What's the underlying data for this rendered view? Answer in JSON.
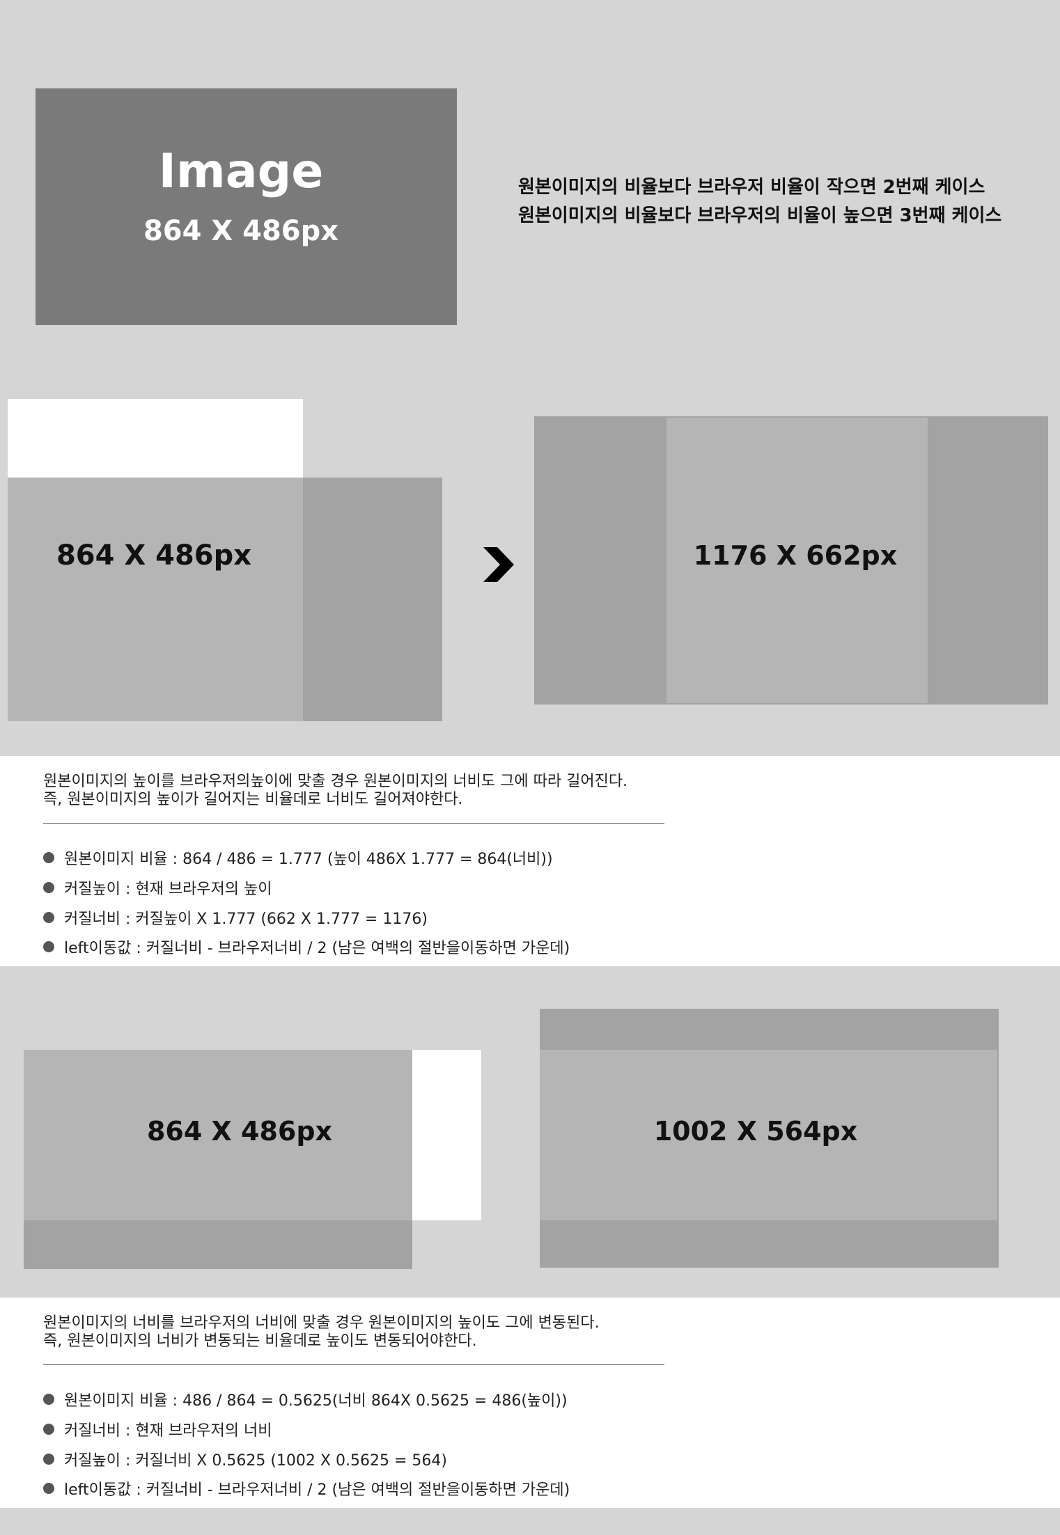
{
  "colors": {
    "background": "#d5d5d5",
    "image_block": "#7a7a7a",
    "light_box": "#b5b5b5",
    "mid_box": "#a3a3a3",
    "white": "#ffffff"
  },
  "top": {
    "image_title": "Image",
    "image_size": "864 X 486px",
    "note_line_1": "원본이미지의 비율보다 브라우저 비율이 작으면 2번째 케이스",
    "note_line_2": "원본이미지의 비율보다 브라우저의 비율이 높으면 3번째 케이스"
  },
  "case2": {
    "original_label": "864 X 486px",
    "arrow_icon": "chevron-right-icon",
    "scaled_label": "1176 X 662px",
    "description_1": "원본이미지의 높이를 브라우저의높이에 맞출 경우 원본이미지의 너비도 그에 따라 길어진다.",
    "description_2": "즉, 원본이미지의 높이가 길어지는 비율데로 너비도 길어져야한다.",
    "bullets": [
      "원본이미지 비율 : 864 / 486 = 1.777 (높이 486X 1.777 = 864(너비))",
      "커질높이 : 현재 브라우저의 높이",
      "커질너비 : 커질높이 X 1.777 (662 X 1.777 = 1176)",
      "left이동값 : 커질너비 - 브라우저너비 / 2 (남은 여백의 절반을이동하면 가운데)"
    ]
  },
  "case3": {
    "original_label": "864 X 486px",
    "scaled_label": "1002 X 564px",
    "description_1": "원본이미지의 너비를 브라우저의 너비에 맞출 경우 원본이미지의 높이도 그에 변동된다.",
    "description_2": "즉, 원본이미지의 너비가 변동되는 비율데로 높이도 변동되어야한다.",
    "bullets": [
      "원본이미지 비율 : 486 / 864 = 0.5625(너비 864X 0.5625 = 486(높이))",
      "커질너비 : 현재 브라우저의 너비",
      "커질높이 : 커질너비 X 0.5625 (1002 X 0.5625 = 564)",
      "left이동값 : 커질너비 - 브라우저너비 / 2 (남은 여백의 절반을이동하면 가운데)"
    ]
  }
}
